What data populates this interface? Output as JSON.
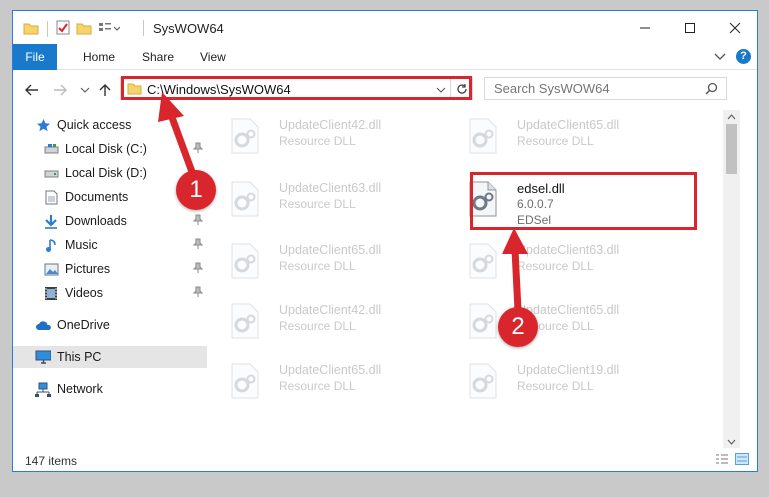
{
  "window": {
    "title": "SysWOW64"
  },
  "ribbon": {
    "tabs": [
      "File",
      "Home",
      "Share",
      "View"
    ]
  },
  "address": {
    "path": "C:\\Windows\\SysWOW64",
    "search_placeholder": "Search SysWOW64"
  },
  "sidebar": {
    "items": [
      {
        "label": "Quick access",
        "icon": "star-icon"
      },
      {
        "label": "Local Disk (C:)",
        "icon": "drive-icon",
        "pinned": true
      },
      {
        "label": "Local Disk (D:)",
        "icon": "drive-icon"
      },
      {
        "label": "Documents",
        "icon": "documents-icon",
        "pinned": true
      },
      {
        "label": "Downloads",
        "icon": "download-icon",
        "pinned": true
      },
      {
        "label": "Music",
        "icon": "music-icon",
        "pinned": true
      },
      {
        "label": "Pictures",
        "icon": "pictures-icon",
        "pinned": true
      },
      {
        "label": "Videos",
        "icon": "videos-icon",
        "pinned": true
      },
      {
        "label": "OneDrive",
        "icon": "cloud-icon"
      },
      {
        "label": "This PC",
        "icon": "computer-icon",
        "selected": true
      },
      {
        "label": "Network",
        "icon": "network-icon"
      }
    ]
  },
  "files": [
    {
      "name": "UpdateClient42.dll",
      "desc": "Resource DLL"
    },
    {
      "name": "UpdateClient65.dll",
      "desc": "Resource DLL"
    },
    {
      "name": "UpdateClient63.dll",
      "desc": "Resource DLL"
    },
    {
      "name": "edsel.dll",
      "version": "6.0.0.7",
      "desc": "EDSel",
      "highlighted": true
    },
    {
      "name": "UpdateClient65.dll",
      "desc": "Resource DLL"
    },
    {
      "name": "UpdateClient63.dll",
      "desc": "Resource DLL"
    },
    {
      "name": "UpdateClient42.dll",
      "desc": "Resource DLL"
    },
    {
      "name": "UpdateClient65.dll",
      "desc": "Resource DLL"
    },
    {
      "name": "UpdateClient65.dll",
      "desc": "Resource DLL"
    },
    {
      "name": "UpdateClient19.dll",
      "desc": "Resource DLL"
    }
  ],
  "status": {
    "item_count": "147 items"
  },
  "annotations": {
    "step1": "1",
    "step2": "2",
    "color": "#d9262c"
  },
  "colors": {
    "accent": "#1979ca",
    "selection": "#cce8ff",
    "highlight_border": "#d9262c"
  }
}
